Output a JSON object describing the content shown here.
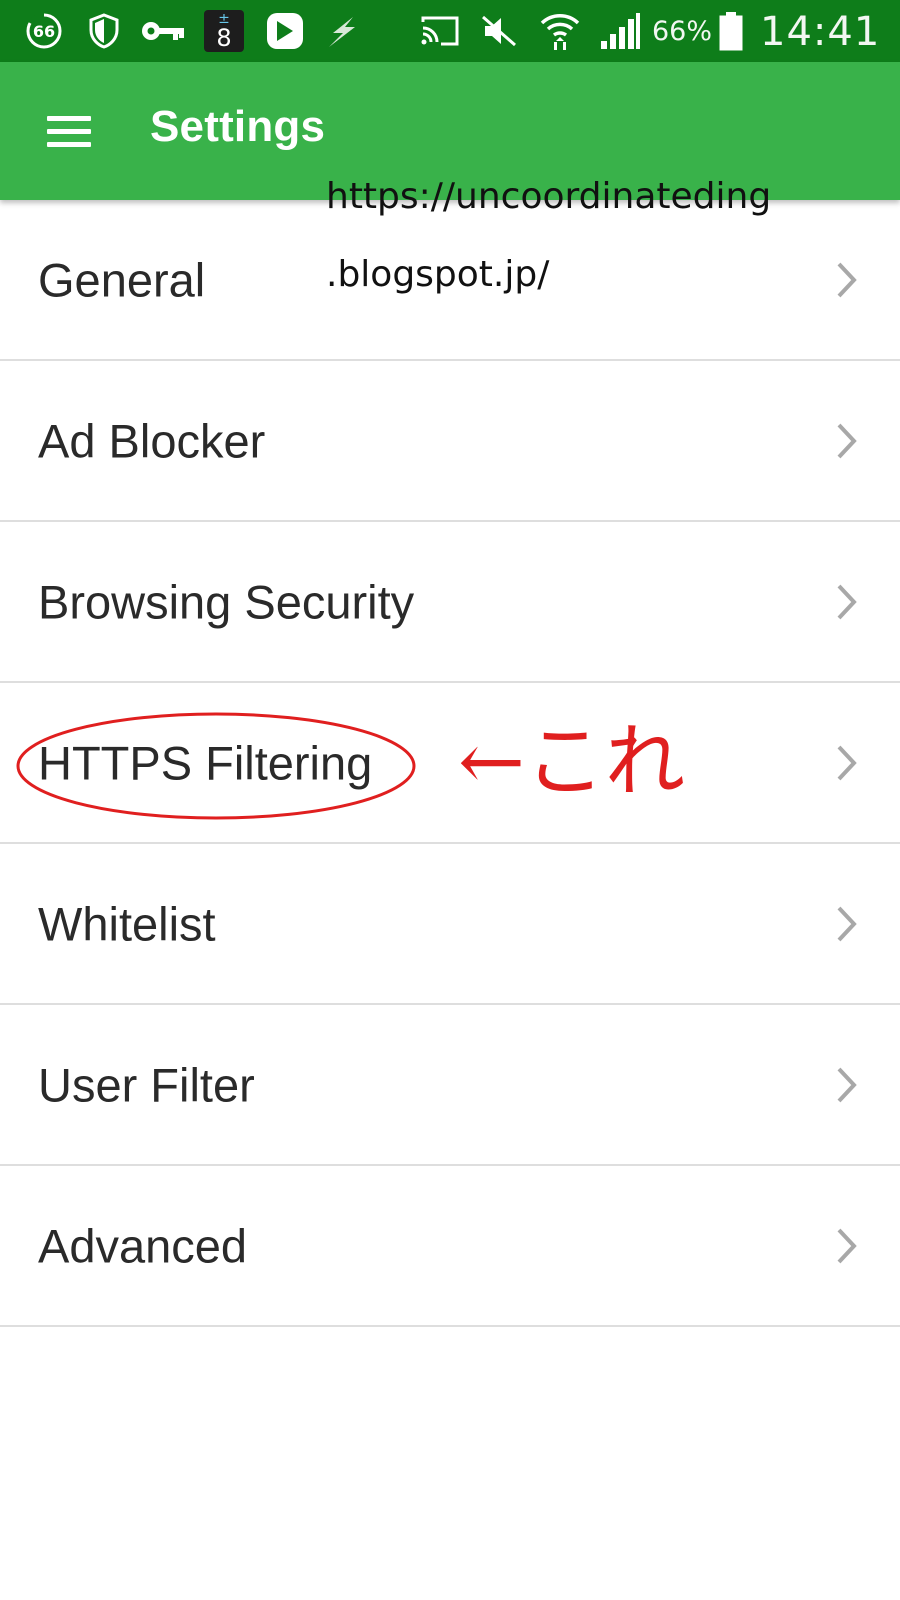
{
  "status_bar": {
    "background": "#0e7d1a",
    "icons": [
      "data-saver-66-icon",
      "shield-icon",
      "key-icon",
      "ime-8-icon",
      "line-app-icon",
      "bolt-icon",
      "cast-icon",
      "mute-icon",
      "wifi-icon",
      "signal-icon",
      "battery-icon"
    ],
    "notif_badge": "66",
    "ime_badge_top": "±",
    "ime_badge_bottom": "8",
    "battery": "66%",
    "time": "14:41"
  },
  "app_bar": {
    "title": "Settings",
    "background": "#39b24a",
    "menu_icon": "hamburger-menu-icon"
  },
  "settings_items": [
    {
      "label": "General"
    },
    {
      "label": "Ad Blocker"
    },
    {
      "label": "Browsing Security"
    },
    {
      "label": "HTTPS Filtering"
    },
    {
      "label": "Whitelist"
    },
    {
      "label": "User Filter"
    },
    {
      "label": "Advanced"
    }
  ],
  "row_icon": "chevron-right-icon",
  "overlay": {
    "watermark_line1": "https://uncoordinateding",
    "watermark_line2": ".blogspot.jp/",
    "annotation_text": "←これ",
    "annotation_color": "#e01f1f"
  }
}
